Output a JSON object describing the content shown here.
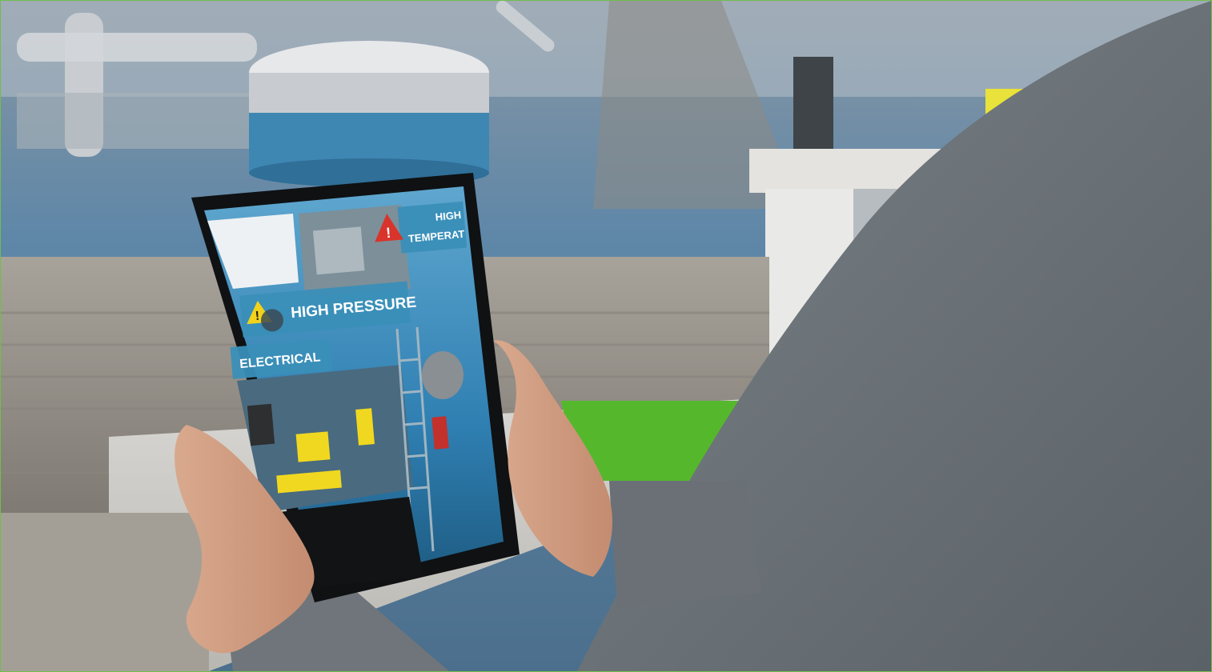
{
  "photo": {
    "subject": "tablet-ar-hazard-overlay",
    "colors": {
      "border": "#6fbf4a",
      "floor": "#4f7da0",
      "label_panel": "#3a8fb8",
      "warning_yellow": "#f2d21a",
      "warning_red": "#d8342c",
      "sleeve": "#6f757b",
      "green_mat": "#55b82c"
    }
  },
  "ar_labels": {
    "high_pressure": "HIGH PRESSURE",
    "electrical": "ELECTRICAL",
    "high_temp_line1": "HIGH",
    "high_temp_line2": "TEMPERAT"
  },
  "icons": {
    "pressure_warning": "warning-triangle-yellow",
    "temperature_warning": "warning-triangle-red"
  }
}
